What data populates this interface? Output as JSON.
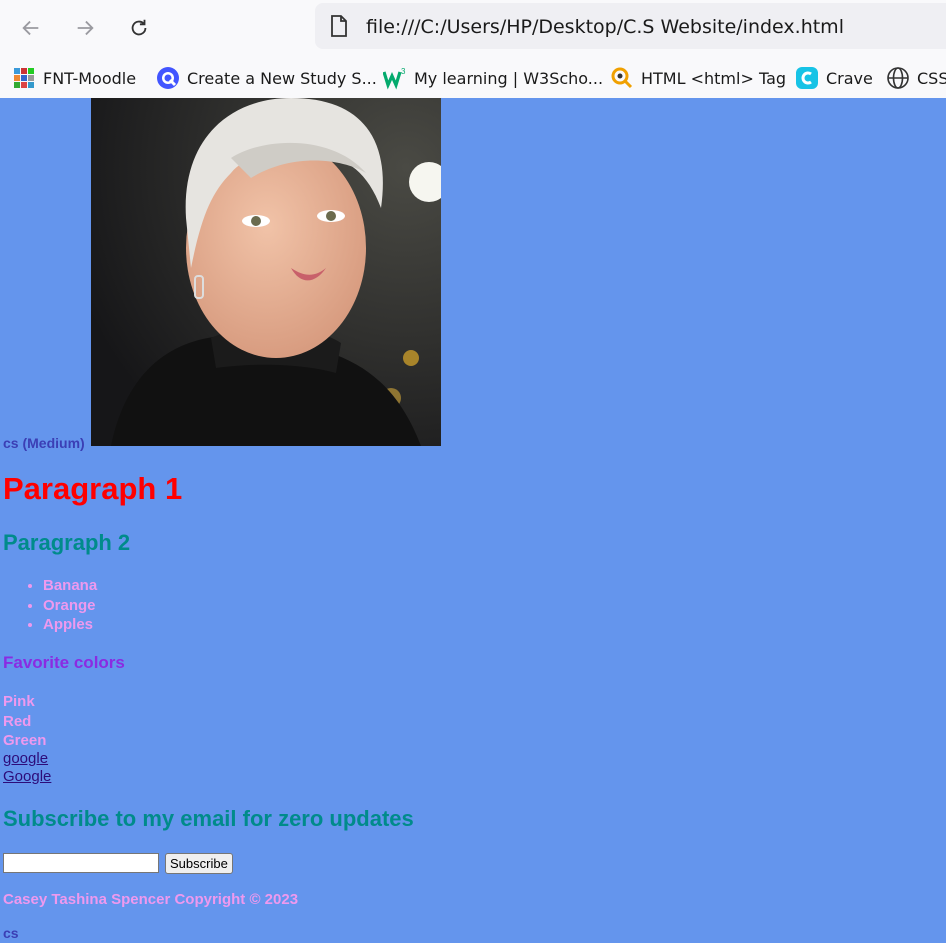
{
  "browser": {
    "url": "file:///C:/Users/HP/Desktop/C.S Website/index.html",
    "bookmarks": [
      {
        "label": "FNT-Moodle",
        "icon": "moodle-icon"
      },
      {
        "label": "Create a New Study S...",
        "icon": "quizlet-icon"
      },
      {
        "label": "My learning | W3Scho...",
        "icon": "w3schools-icon"
      },
      {
        "label": "HTML <html> Tag",
        "icon": "search-tag-icon"
      },
      {
        "label": "Crave",
        "icon": "crave-icon"
      },
      {
        "label": "CSS",
        "icon": "globe-icon"
      }
    ]
  },
  "page": {
    "image_caption": "cs (Medium)",
    "heading1": "Paragraph 1",
    "heading2": "Paragraph 2",
    "fruits": [
      "Banana",
      "Orange",
      "Apples"
    ],
    "favorite_heading": "Favorite colors",
    "colors": [
      "Pink",
      "Red",
      "Green"
    ],
    "links": [
      "google",
      "Google"
    ],
    "subscribe_heading": "Subscribe to my email for zero updates",
    "email_value": "",
    "subscribe_button": "Subscribe",
    "copyright": "Casey Tashina Spencer Copyright © 2023",
    "footer": "cs"
  },
  "colors": {
    "background": "#6495ed",
    "heading1": "#ff0000",
    "heading2": "#008b8b",
    "list_text": "#ee99ee",
    "favorite_heading": "#8a2be2",
    "caption": "#3b3fb5",
    "link": "#2d0c7a"
  }
}
